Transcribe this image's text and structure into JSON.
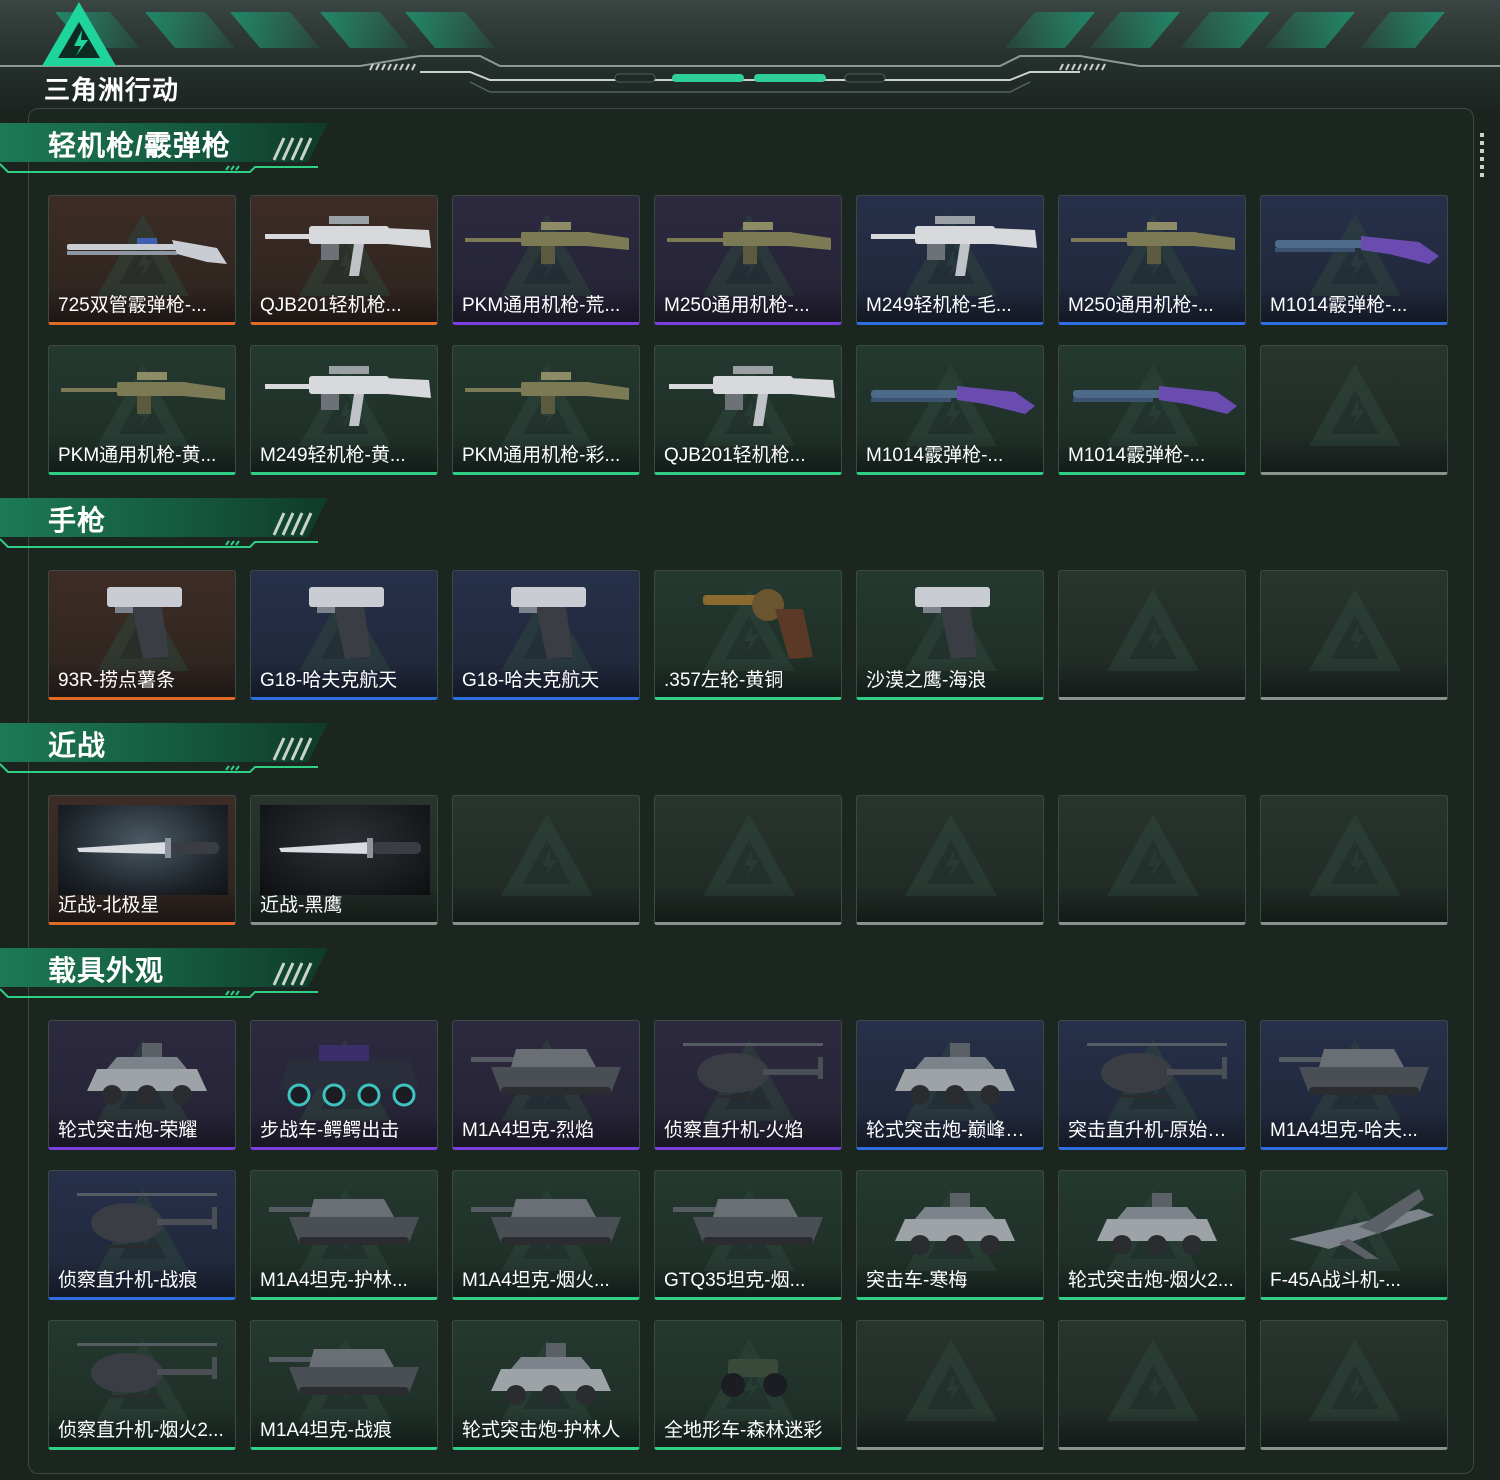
{
  "app": {
    "logo_text": "三角洲行动"
  },
  "colors": {
    "background": "#1a231e",
    "accent": "#2fcf86",
    "rarity_orange": "#e26a27",
    "rarity_purple": "#7b3fe0",
    "rarity_blue": "#2f6ee0",
    "rarity_green": "#2fcf86",
    "rarity_grey": "#8b928e"
  },
  "sections": [
    {
      "title": "轻机枪/霰弹枪",
      "items": [
        {
          "label": "725双管霰弹枪-...",
          "rarity": "orange",
          "icon": "shotgun-double-barrel"
        },
        {
          "label": "QJB201轻机枪...",
          "rarity": "orange",
          "icon": "light-machine-gun"
        },
        {
          "label": "PKM通用机枪-荒...",
          "rarity": "purple",
          "icon": "machine-gun"
        },
        {
          "label": "M250通用机枪-...",
          "rarity": "purple",
          "icon": "machine-gun"
        },
        {
          "label": "M249轻机枪-毛...",
          "rarity": "blue",
          "icon": "light-machine-gun"
        },
        {
          "label": "M250通用机枪-...",
          "rarity": "blue",
          "icon": "machine-gun"
        },
        {
          "label": "M1014霰弹枪-...",
          "rarity": "blue",
          "icon": "shotgun"
        },
        {
          "label": "PKM通用机枪-黄...",
          "rarity": "green",
          "icon": "machine-gun"
        },
        {
          "label": "M249轻机枪-黄...",
          "rarity": "green",
          "icon": "light-machine-gun"
        },
        {
          "label": "PKM通用机枪-彩...",
          "rarity": "green",
          "icon": "machine-gun"
        },
        {
          "label": "QJB201轻机枪...",
          "rarity": "green",
          "icon": "light-machine-gun"
        },
        {
          "label": "M1014霰弹枪-...",
          "rarity": "green",
          "icon": "shotgun"
        },
        {
          "label": "M1014霰弹枪-...",
          "rarity": "green",
          "icon": "shotgun"
        },
        {
          "label": "",
          "rarity": "grey",
          "icon": "empty-slot"
        }
      ]
    },
    {
      "title": "手枪",
      "items": [
        {
          "label": "93R-捞点薯条",
          "rarity": "orange",
          "icon": "pistol"
        },
        {
          "label": "G18-哈夫克航天",
          "rarity": "blue",
          "icon": "pistol"
        },
        {
          "label": "G18-哈夫克航天",
          "rarity": "blue",
          "icon": "pistol"
        },
        {
          "label": ".357左轮-黄铜",
          "rarity": "green",
          "icon": "revolver"
        },
        {
          "label": "沙漠之鹰-海浪",
          "rarity": "green",
          "icon": "pistol"
        },
        {
          "label": "",
          "rarity": "grey",
          "icon": "empty-slot"
        },
        {
          "label": "",
          "rarity": "grey",
          "icon": "empty-slot"
        }
      ]
    },
    {
      "title": "近战",
      "items": [
        {
          "label": "近战-北极星",
          "rarity": "orange",
          "icon": "knife"
        },
        {
          "label": "近战-黑鹰",
          "rarity": "grey",
          "icon": "knife"
        },
        {
          "label": "",
          "rarity": "grey",
          "icon": "empty-slot"
        },
        {
          "label": "",
          "rarity": "grey",
          "icon": "empty-slot"
        },
        {
          "label": "",
          "rarity": "grey",
          "icon": "empty-slot"
        },
        {
          "label": "",
          "rarity": "grey",
          "icon": "empty-slot"
        },
        {
          "label": "",
          "rarity": "grey",
          "icon": "empty-slot"
        }
      ]
    },
    {
      "title": "载具外观",
      "items": [
        {
          "label": "轮式突击炮-荣耀",
          "rarity": "purple",
          "icon": "armored-car"
        },
        {
          "label": "步战车-鳄鳄出击",
          "rarity": "purple",
          "icon": "ifv"
        },
        {
          "label": "M1A4坦克-烈焰",
          "rarity": "purple",
          "icon": "tank"
        },
        {
          "label": "侦察直升机-火焰",
          "rarity": "purple",
          "icon": "helicopter"
        },
        {
          "label": "轮式突击炮-巅峰竞...",
          "rarity": "blue",
          "icon": "armored-car"
        },
        {
          "label": "突击直升机-原始伪...",
          "rarity": "blue",
          "icon": "helicopter"
        },
        {
          "label": "M1A4坦克-哈夫...",
          "rarity": "blue",
          "icon": "tank"
        },
        {
          "label": "侦察直升机-战痕",
          "rarity": "blue",
          "icon": "helicopter"
        },
        {
          "label": "M1A4坦克-护林...",
          "rarity": "green",
          "icon": "tank"
        },
        {
          "label": "M1A4坦克-烟火...",
          "rarity": "green",
          "icon": "tank"
        },
        {
          "label": "GTQ35坦克-烟...",
          "rarity": "green",
          "icon": "tank"
        },
        {
          "label": "突击车-寒梅",
          "rarity": "green",
          "icon": "armored-car"
        },
        {
          "label": "轮式突击炮-烟火2...",
          "rarity": "green",
          "icon": "armored-car"
        },
        {
          "label": "F-45A战斗机-...",
          "rarity": "green",
          "icon": "jet"
        },
        {
          "label": "侦察直升机-烟火2...",
          "rarity": "green",
          "icon": "helicopter"
        },
        {
          "label": "M1A4坦克-战痕",
          "rarity": "green",
          "icon": "tank"
        },
        {
          "label": "轮式突击炮-护林人",
          "rarity": "green",
          "icon": "armored-car"
        },
        {
          "label": "全地形车-森林迷彩",
          "rarity": "green",
          "icon": "atv"
        },
        {
          "label": "",
          "rarity": "grey",
          "icon": "empty-slot"
        },
        {
          "label": "",
          "rarity": "grey",
          "icon": "empty-slot"
        },
        {
          "label": "",
          "rarity": "grey",
          "icon": "empty-slot"
        }
      ]
    }
  ]
}
